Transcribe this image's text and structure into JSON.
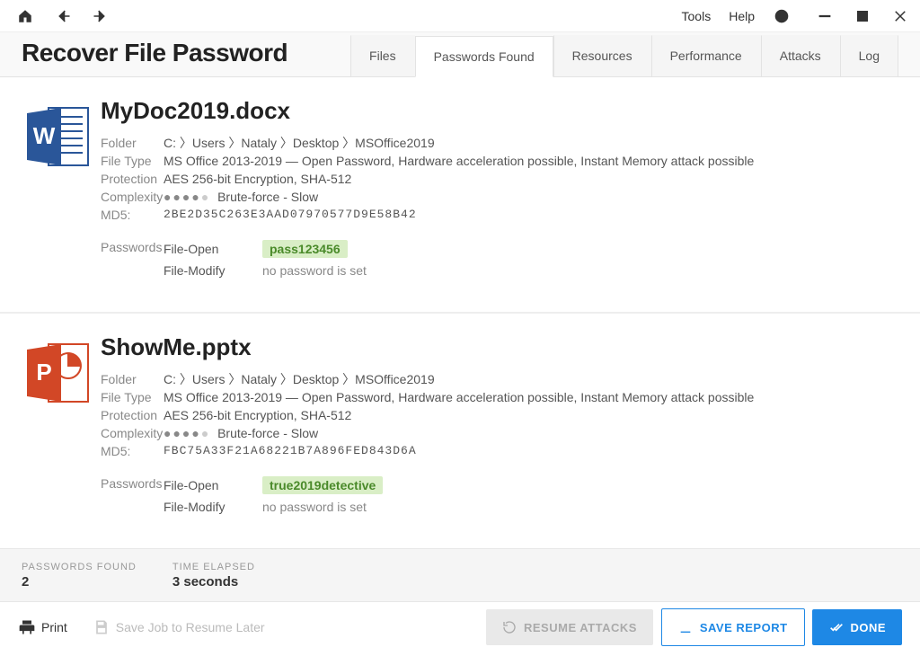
{
  "titlebar": {
    "menu_tools": "Tools",
    "menu_help": "Help"
  },
  "header": {
    "title": "Recover File Password"
  },
  "tabs": [
    {
      "label": "Files",
      "active": false
    },
    {
      "label": "Passwords Found",
      "active": true
    },
    {
      "label": "Resources",
      "active": false
    },
    {
      "label": "Performance",
      "active": false
    },
    {
      "label": "Attacks",
      "active": false
    },
    {
      "label": "Log",
      "active": false
    }
  ],
  "files": [
    {
      "name": "MyDoc2019.docx",
      "icon": "word",
      "folder": "C: 〉Users 〉Nataly 〉Desktop 〉MSOffice2019",
      "file_type": "MS Office 2013-2019 — Open Password, Hardware acceleration possible, Instant Memory attack possible",
      "protection": "AES 256-bit Encryption, SHA-512",
      "complexity_label": "Brute-force - Slow",
      "complexity_dots_filled": 4,
      "complexity_dots_total": 5,
      "md5": "2BE2D35C263E3AAD07970577D9E58B42",
      "passwords": [
        {
          "type": "File-Open",
          "value": "pass123456",
          "found": true
        },
        {
          "type": "File-Modify",
          "value": "no password is set",
          "found": false
        }
      ]
    },
    {
      "name": "ShowMe.pptx",
      "icon": "powerpoint",
      "folder": "C: 〉Users 〉Nataly 〉Desktop 〉MSOffice2019",
      "file_type": "MS Office 2013-2019 — Open Password, Hardware acceleration possible, Instant Memory attack possible",
      "protection": "AES 256-bit Encryption, SHA-512",
      "complexity_label": "Brute-force - Slow",
      "complexity_dots_filled": 4,
      "complexity_dots_total": 5,
      "md5": "FBC75A33F21A68221B7A896FED843D6A",
      "passwords": [
        {
          "type": "File-Open",
          "value": "true2019detective",
          "found": true
        },
        {
          "type": "File-Modify",
          "value": "no password is set",
          "found": false
        }
      ]
    }
  ],
  "labels": {
    "folder": "Folder",
    "file_type": "File Type",
    "protection": "Protection",
    "complexity": "Complexity",
    "md5": "MD5:",
    "passwords": "Passwords"
  },
  "stats": {
    "passwords_found_label": "PASSWORDS FOUND",
    "passwords_found_value": "2",
    "time_elapsed_label": "TIME ELAPSED",
    "time_elapsed_value": "3 seconds"
  },
  "actions": {
    "print": "Print",
    "save_job": "Save Job to Resume Later",
    "resume_attacks": "RESUME ATTACKS",
    "save_report": "SAVE REPORT",
    "done": "DONE"
  }
}
